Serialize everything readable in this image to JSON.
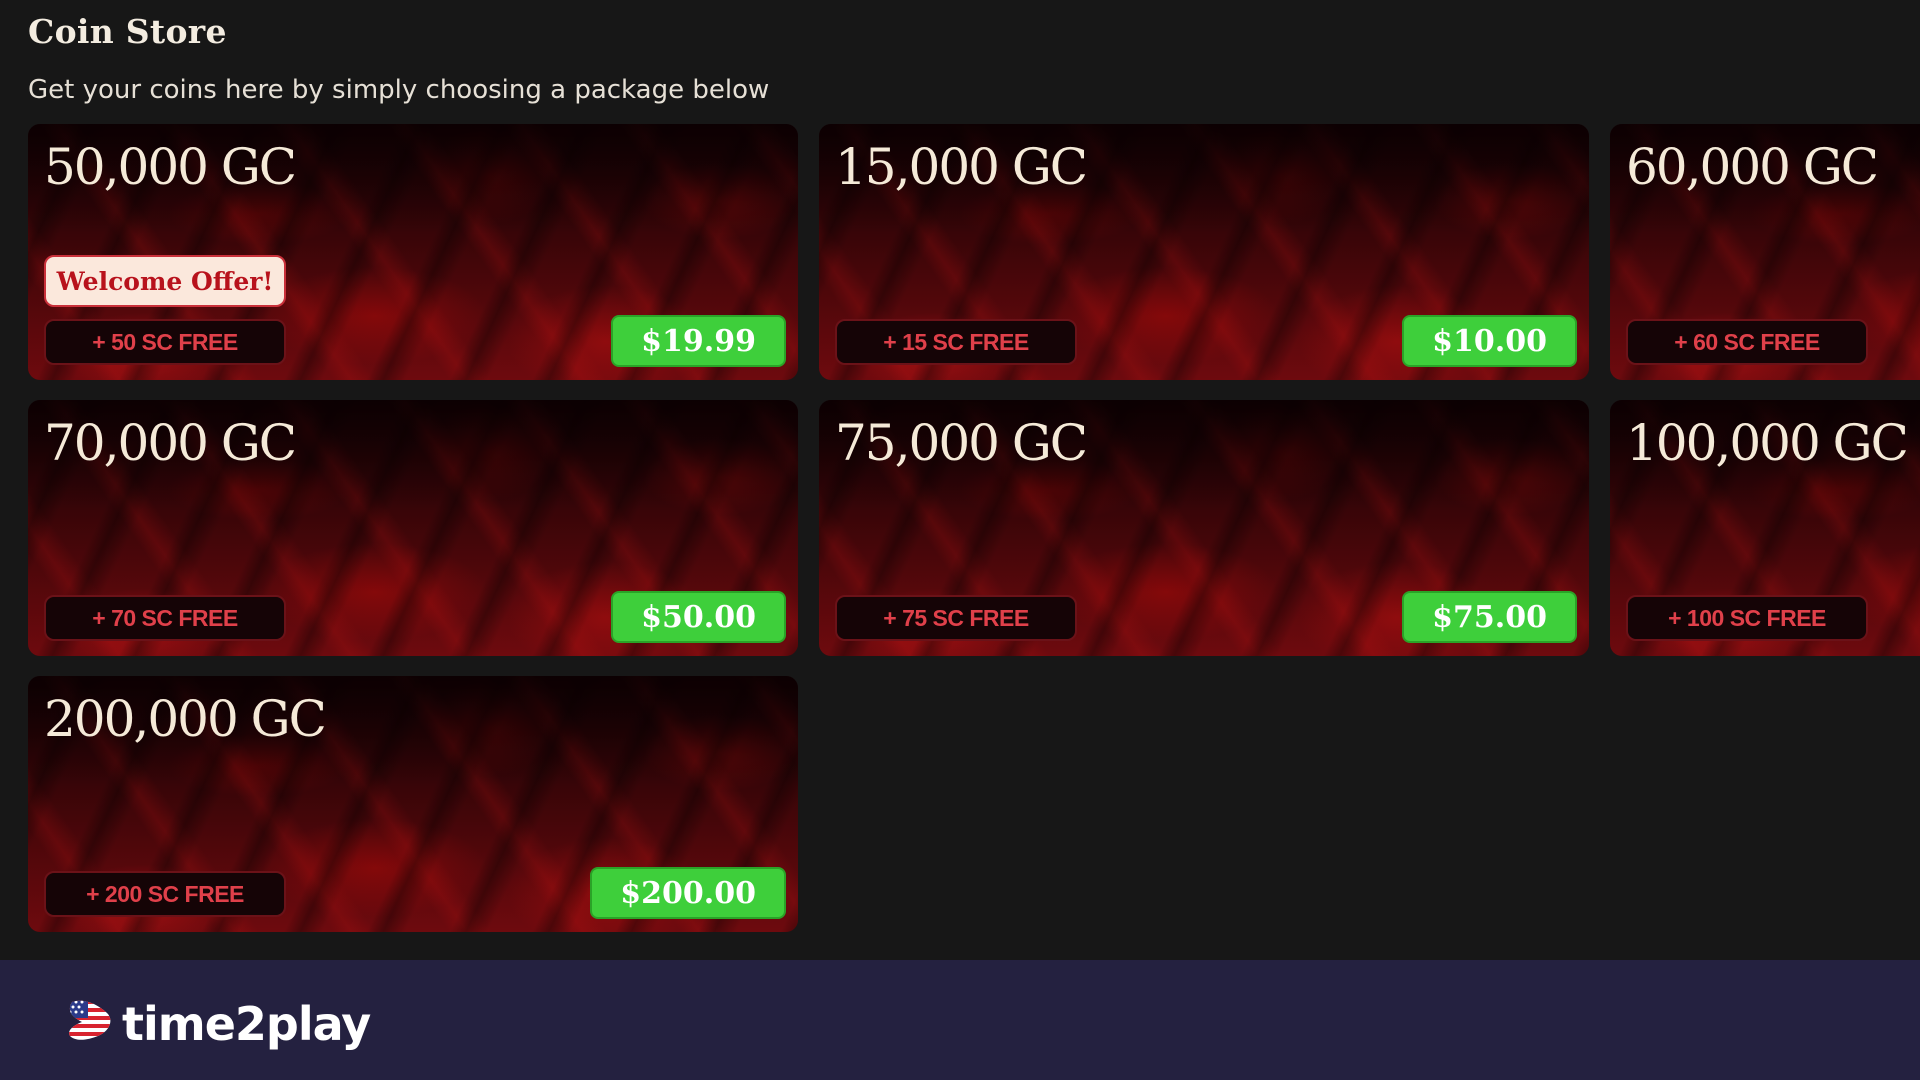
{
  "store": {
    "title": "Coin Store",
    "subtitle": "Get your coins here by simply choosing a package below"
  },
  "packages": [
    {
      "amount": "50,000 GC",
      "badge": "Welcome Offer!",
      "bonus": "+ 50 SC FREE",
      "price": "$19.99"
    },
    {
      "amount": "15,000 GC",
      "bonus": "+ 15 SC FREE",
      "price": "$10.00"
    },
    {
      "amount": "60,000 GC",
      "bonus": "+ 60 SC FREE"
    },
    {
      "amount": "70,000 GC",
      "bonus": "+ 70 SC FREE",
      "price": "$50.00"
    },
    {
      "amount": "75,000 GC",
      "bonus": "+ 75 SC FREE",
      "price": "$75.00"
    },
    {
      "amount": "100,000 GC",
      "bonus": "+ 100 SC FREE"
    },
    {
      "amount": "200,000 GC",
      "bonus": "+ 200 SC FREE",
      "price": "$200.00"
    }
  ],
  "footer": {
    "logo_text": "time2play",
    "logo_icon": "us-flag-icon"
  },
  "colors": {
    "page_bg": "#171717",
    "price_button": "#3ecf3b",
    "bonus_text": "#e0404a",
    "footer_bg": "#242140"
  }
}
